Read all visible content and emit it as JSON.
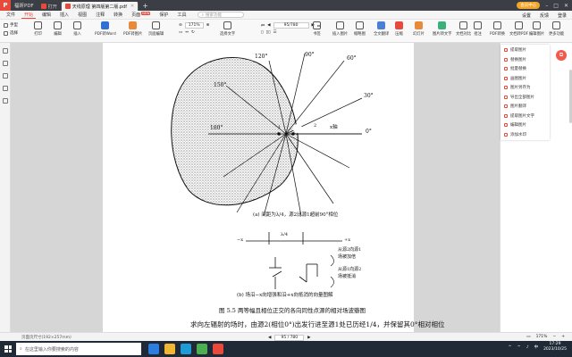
{
  "titlebar": {
    "app_name": "福昕PDF",
    "tabs": [
      {
        "label": "打开",
        "active": false
      },
      {
        "label": "天线原理 第四版第二版.pdf",
        "active": true
      }
    ],
    "member_label": "会员中心"
  },
  "menubar": {
    "items": [
      "文件",
      "开始",
      "编辑",
      "插入",
      "视图",
      "注释",
      "转换",
      "页面",
      "保护",
      "工具"
    ],
    "active": "开始",
    "new_badge": "NEW",
    "search_placeholder": "搜索功能",
    "right": [
      "设置",
      "反馈",
      "登录"
    ]
  },
  "toolbar": {
    "left": [
      "手型",
      "选择"
    ],
    "buttons": [
      "打印",
      "编辑",
      "插入",
      "PDF转Word",
      "PDF转图片",
      "页面编辑",
      "选择文字"
    ],
    "zoom": "171%",
    "page": "95/780",
    "right": [
      "书签",
      "插入图片",
      "缩略图",
      "全文翻译",
      "压缩",
      "幻灯片",
      "图片转文字",
      "文档对比",
      "批注",
      "PDF转换",
      "文档转PDF",
      "编辑图片",
      "更多功能"
    ]
  },
  "figure": {
    "angles": [
      "120°",
      "90°",
      "60°",
      "150°",
      "30°",
      "180°",
      "0°"
    ],
    "source_num_1": "1",
    "source_num_2": "2",
    "axis_label": "x轴",
    "caption_a": "(a) 间距为λ/4，源2比源1超前90°相位",
    "lambda_frac": "λ/4",
    "x_left": "−x",
    "x_right": "+x",
    "annot_1": "从源2向源1",
    "annot_1b": "场被加倍",
    "annot_2": "从源1向源2",
    "annot_2b": "场被抵消",
    "caption_b": "(b) 场沿−x向增强和沿+x向抵消的向量图解",
    "fig_title": "图 5.5    两等幅且相位正交的各向同性点源的相对场波瓣图",
    "body_text": "求向左辐射的场时，由源2(相位0°)出发行进至源1处已历经1/4，并保留其0°相对相位"
  },
  "right_panel": {
    "items": [
      "提取图片",
      "替换图片",
      "批量替换",
      "画图图片",
      "图片另存为",
      "导出全部图片",
      "图片翻译",
      "提取图片文字",
      "编辑图片",
      "添加水印"
    ]
  },
  "statusbar": {
    "left": "页面页尺寸(192×257mm)",
    "page": "95 / 780",
    "zoom": "171%"
  },
  "taskbar": {
    "search": "在这里输入你要搜索的内容",
    "time": "17:29",
    "date": "2023/10/25",
    "lang": "中"
  },
  "colors": {
    "brand": "#e9493b",
    "member": "#f1a62a"
  }
}
